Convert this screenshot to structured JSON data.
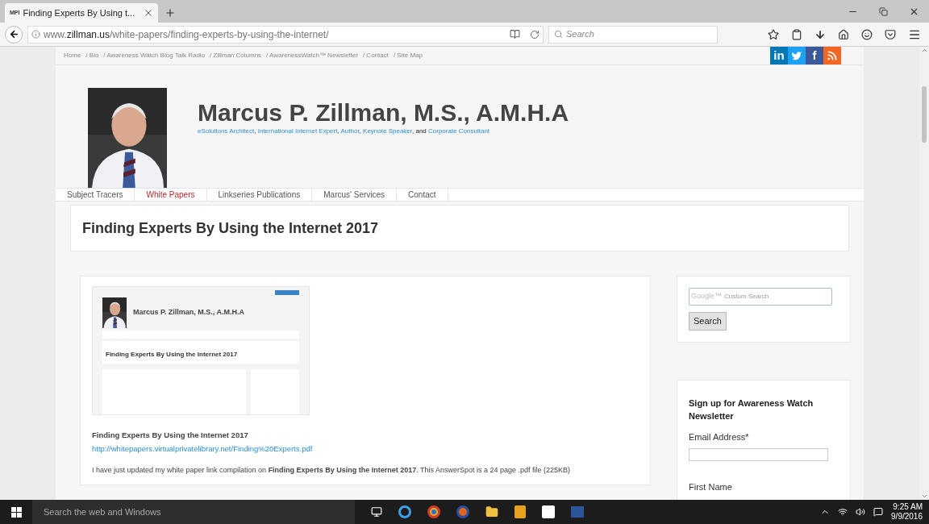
{
  "browser": {
    "tab_title": "Finding Experts By Using t...",
    "favicon": "MPI",
    "url_prefix": "www.",
    "url_domain": "zillman.us",
    "url_path": "/white-papers/finding-experts-by-using-the-internet/",
    "search_placeholder": "Search"
  },
  "breadcrumbs": [
    "Home",
    "/ Bio",
    "/ Awareness Watch Blog Talk Radio",
    "/ Zillman Columns",
    "/ AwarenessWatch™ Newsletter",
    "/ Contact",
    "/ Site Map"
  ],
  "social": [
    {
      "kind": "linkedin",
      "label": "in",
      "color": "#0077b5"
    },
    {
      "kind": "twitter",
      "color": "#1da1f2"
    },
    {
      "kind": "facebook",
      "label": "f",
      "color": "#3b5998"
    },
    {
      "kind": "rss",
      "color": "#f26522"
    }
  ],
  "header": {
    "title": "Marcus P. Zillman, M.S., A.M.H.A",
    "subtitle": {
      "links": [
        "eSolutions Architect",
        "International Internet Expert",
        "Author",
        "Keynote Speaker",
        "Corporate Consultant"
      ],
      "separators": [
        ", ",
        ", ",
        ", ",
        ", and "
      ]
    }
  },
  "nav": [
    {
      "label": "Subject Tracers",
      "selected": false
    },
    {
      "label": "White Papers",
      "selected": true
    },
    {
      "label": "Linkseries Publications",
      "selected": false
    },
    {
      "label": "Marcus' Services",
      "selected": false
    },
    {
      "label": "Contact",
      "selected": false
    }
  ],
  "page_title": "Finding Experts By Using the Internet 2017",
  "article": {
    "thumbnail": {
      "title": "Marcus P. Zillman, M.S., A.M.H.A",
      "page_title": "Finding Experts By Using the Internet 2017"
    },
    "heading": "Finding Experts By Using the Internet 2017",
    "link": "http://whitepapers.virtualprivatelibrary.net/Finding%20Experts.pdf",
    "paragraph": "I have just updated my white paper link compilation on **Finding Experts By Using the Internet 2017**. This AnswerSpot is a 24 page .pdf file (225KB)"
  },
  "sidebar": {
    "search_placeholder": "Custom Search",
    "search_brand": "Google™",
    "search_button": "Search",
    "newsletter_title": "Sign up for Awareness Watch Newsletter",
    "email_label": "Email Address*",
    "first_name_label": "First Name"
  },
  "taskbar": {
    "search_placeholder": "Search the web and Windows",
    "time": "9:25 AM",
    "date": "9/9/2016"
  }
}
